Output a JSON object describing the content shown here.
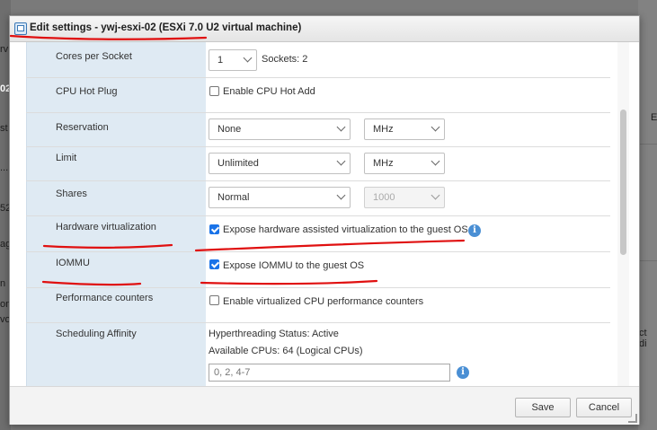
{
  "background": {
    "fragments": [
      "rv",
      "02",
      "st",
      "...",
      "52",
      "ag",
      "n",
      "on",
      "vo",
      "E",
      "ct di"
    ]
  },
  "dialog": {
    "title": "Edit settings - ywj-esxi-02 (ESXi 7.0 U2 virtual machine)",
    "rows": {
      "cores_per_socket": {
        "label": "Cores per Socket",
        "select": "1",
        "sockets_text": "Sockets: 2"
      },
      "cpu_hot_plug": {
        "label": "CPU Hot Plug",
        "checkbox_label": "Enable CPU Hot Add",
        "checked": false
      },
      "reservation": {
        "label": "Reservation",
        "value": "None",
        "unit": "MHz"
      },
      "limit": {
        "label": "Limit",
        "value": "Unlimited",
        "unit": "MHz"
      },
      "shares": {
        "label": "Shares",
        "value": "Normal",
        "amount": "1000"
      },
      "hardware_virtualization": {
        "label": "Hardware virtualization",
        "checkbox_label": "Expose hardware assisted virtualization to the guest OS",
        "checked": true
      },
      "iommu": {
        "label": "IOMMU",
        "checkbox_label": "Expose IOMMU to the guest OS",
        "checked": true
      },
      "performance_counters": {
        "label": "Performance counters",
        "checkbox_label": "Enable virtualized CPU performance counters",
        "checked": false
      },
      "scheduling_affinity": {
        "label": "Scheduling Affinity",
        "hyperthreading": "Hyperthreading Status: Active",
        "available_cpus": "Available CPUs: 64 (Logical CPUs)",
        "placeholder": "0, 2, 4-7"
      }
    },
    "footer": {
      "save": "Save",
      "cancel": "Cancel"
    }
  },
  "colors": {
    "label_bg": "#dfeaf3",
    "checkbox_checked": "#1a73e8",
    "info_icon": "#4a8fd4",
    "annotation": "#e01010"
  },
  "icons": [
    "vm-icon",
    "info-icon",
    "chevron-down-icon",
    "resize-grip-icon"
  ]
}
